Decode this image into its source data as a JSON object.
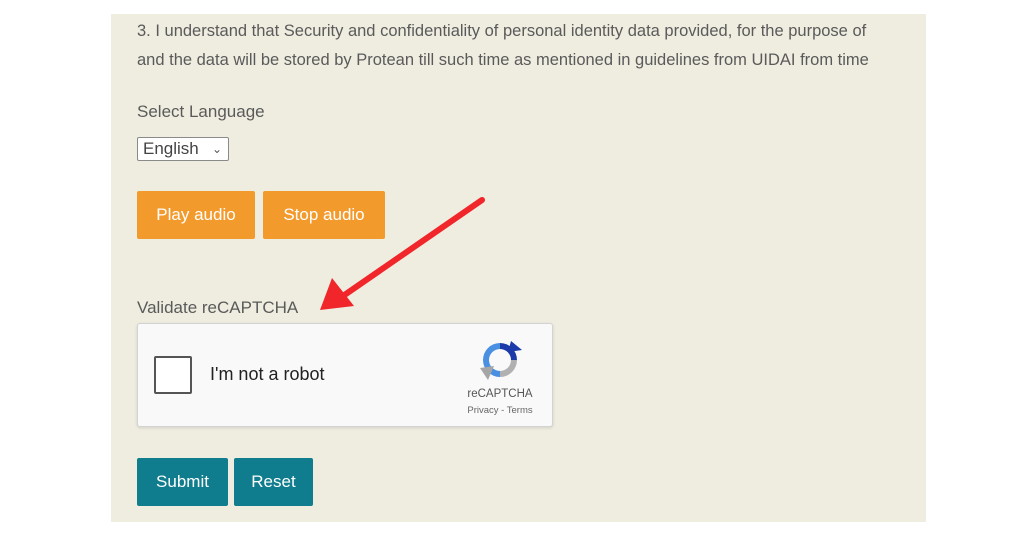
{
  "consent": {
    "line1": "3. I understand that Security and confidentiality of personal identity data provided, for the purpose of",
    "line2": "and the data will be stored by Protean till such time as mentioned in guidelines from UIDAI from time"
  },
  "language": {
    "label": "Select Language",
    "selected": "English",
    "chevron": "⌄"
  },
  "audio": {
    "play_label": "Play audio",
    "stop_label": "Stop audio"
  },
  "captcha": {
    "label": "Validate reCAPTCHA",
    "checkbox_text": "I'm not a robot",
    "brand": "reCAPTCHA",
    "links": "Privacy - Terms"
  },
  "form": {
    "submit_label": "Submit",
    "reset_label": "Reset"
  },
  "colors": {
    "panel_bg": "#efede0",
    "audio_button": "#f39a2c",
    "form_button": "#107d8e",
    "annotation_arrow": "#f0262b"
  },
  "icons": [
    "recaptcha-logo-icon",
    "chevron-down-icon",
    "red-arrow-annotation"
  ]
}
